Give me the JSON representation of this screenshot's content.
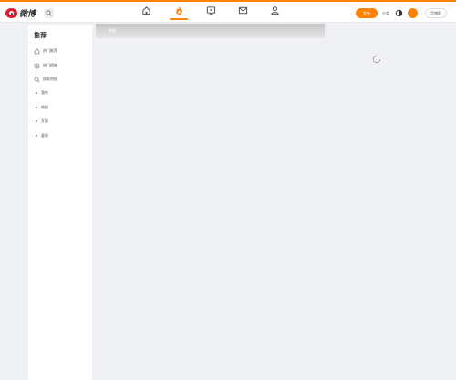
{
  "header": {
    "logo_text": "微博",
    "nav": [
      {
        "name": "home"
      },
      {
        "name": "hot",
        "active": true
      },
      {
        "name": "video"
      },
      {
        "name": "messages"
      },
      {
        "name": "profile"
      }
    ],
    "publish_label": "发布",
    "right_text": "分类",
    "avatar_text": "",
    "switch_label": "写博客"
  },
  "sidebar": {
    "title": "推荐",
    "items": [
      {
        "label": "热门推荐",
        "icon": "hot-recommend-icon"
      },
      {
        "label": "热门榜单",
        "icon": "clock-icon"
      },
      {
        "label": "搜索热搜",
        "icon": "search-icon"
      },
      {
        "label": "我的",
        "icon": "dot"
      },
      {
        "label": "热搜",
        "icon": "dot"
      },
      {
        "label": "文娱",
        "icon": "dot"
      },
      {
        "label": "要闻",
        "icon": "dot"
      }
    ]
  },
  "main": {
    "tab_label": "热搜"
  },
  "colors": {
    "accent": "#ff8200",
    "background": "#f0f1f4",
    "logo_red": "#e6162d"
  }
}
